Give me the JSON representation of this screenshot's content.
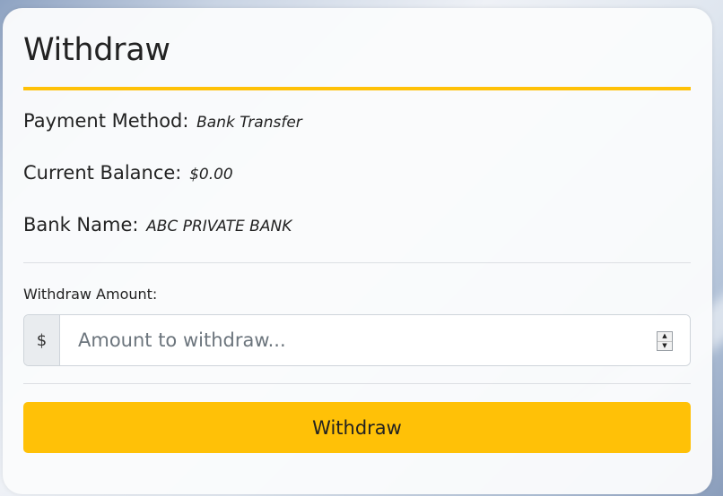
{
  "withdraw": {
    "title": "Withdraw",
    "payment_method": {
      "label": "Payment Method:",
      "value": "Bank Transfer"
    },
    "current_balance": {
      "label": "Current Balance:",
      "value": "$0.00"
    },
    "bank_name": {
      "label": "Bank Name:",
      "value": "ABC PRIVATE BANK"
    },
    "amount_field": {
      "label": "Withdraw Amount:",
      "currency_symbol": "$",
      "value": "",
      "placeholder": "Amount to withdraw..."
    },
    "submit_label": "Withdraw"
  },
  "colors": {
    "accent": "#ffc107",
    "text": "#222222",
    "addon_bg": "#e9ecef"
  },
  "icons": {
    "spinner_up": "up-arrow-icon",
    "spinner_down": "down-arrow-icon"
  }
}
